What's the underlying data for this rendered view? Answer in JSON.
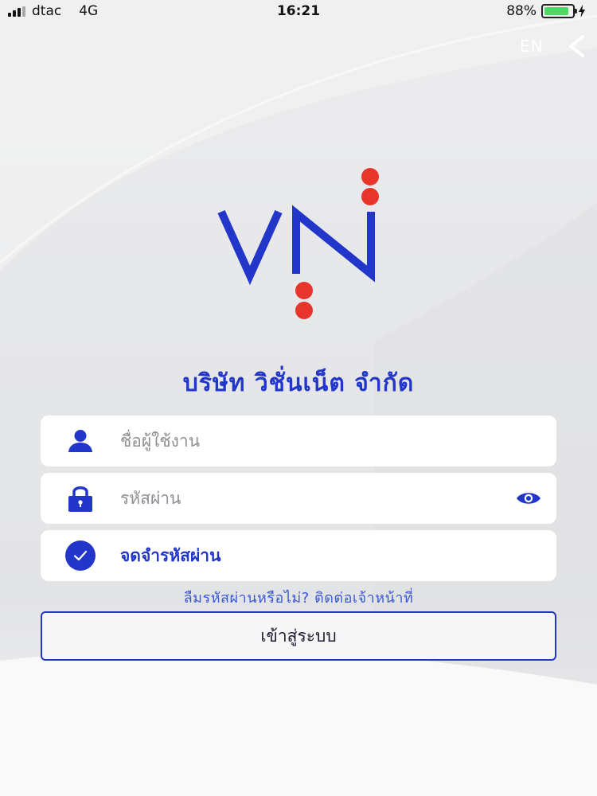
{
  "status_bar": {
    "carrier": "dtac",
    "network": "4G",
    "time": "16:21",
    "battery_percent_label": "88%",
    "battery_level": 0.88
  },
  "nav": {
    "language_label": "EN"
  },
  "company": {
    "name": "บริษัท วิชั่นเน็ต จำกัด"
  },
  "form": {
    "username_placeholder": "ชื่อผู้ใช้งาน",
    "password_placeholder": "รหัสผ่าน",
    "remember_label": "จดจำรหัสผ่าน",
    "remember_checked": true,
    "forgot_link": "ลืมรหัสผ่านหรือไม่? ติดต่อเจ้าหน้าที่",
    "login_label": "เข้าสู่ระบบ"
  },
  "colors": {
    "brand_blue": "#2237c9",
    "logo_red": "#e8352b",
    "link_blue": "#3a58d8",
    "battery_green": "#4cd964"
  },
  "icons": {
    "username": "user-icon",
    "password": "lock-icon",
    "show_password": "eye-icon",
    "remember": "checkmark-circle-icon",
    "back": "chevron-left-icon"
  }
}
